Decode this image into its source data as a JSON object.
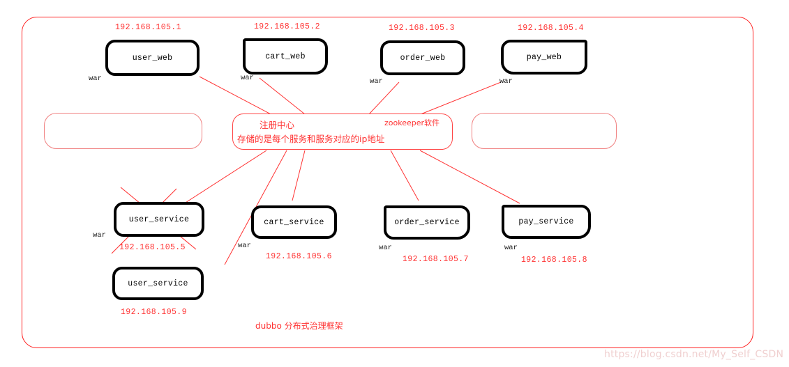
{
  "diagram": {
    "caption": "dubbo 分布式治理框架",
    "watermark": "https://blog.csdn.net/My_Self_CSDN",
    "colors": {
      "red": "#ff3333",
      "red_border": "#ff2222",
      "pale_red": "#f08080",
      "black": "#000000",
      "watermark": "#f0d0d0"
    },
    "registry": {
      "title": "注册中心",
      "subtitle": "存储的是每个服务和服务对应的ip地址",
      "tag": "zookeeper软件"
    },
    "web_nodes": [
      {
        "name": "user_web",
        "ip": "192.168.105.1",
        "artifact": "war"
      },
      {
        "name": "cart_web",
        "ip": "192.168.105.2",
        "artifact": "war"
      },
      {
        "name": "order_web",
        "ip": "192.168.105.3",
        "artifact": "war"
      },
      {
        "name": "pay_web",
        "ip": "192.168.105.4",
        "artifact": "war"
      }
    ],
    "service_nodes": [
      {
        "name": "user_service",
        "ip": "192.168.105.5",
        "artifact": "war",
        "status": "crossed-out"
      },
      {
        "name": "cart_service",
        "ip": "192.168.105.6",
        "artifact": "war",
        "status": "active"
      },
      {
        "name": "order_service",
        "ip": "192.168.105.7",
        "artifact": "war",
        "status": "active"
      },
      {
        "name": "pay_service",
        "ip": "192.168.105.8",
        "artifact": "war",
        "status": "active"
      },
      {
        "name": "user_service",
        "ip": "192.168.105.9",
        "artifact": "",
        "status": "active"
      }
    ],
    "empty_boxes": [
      {
        "label": ""
      },
      {
        "label": ""
      }
    ]
  }
}
